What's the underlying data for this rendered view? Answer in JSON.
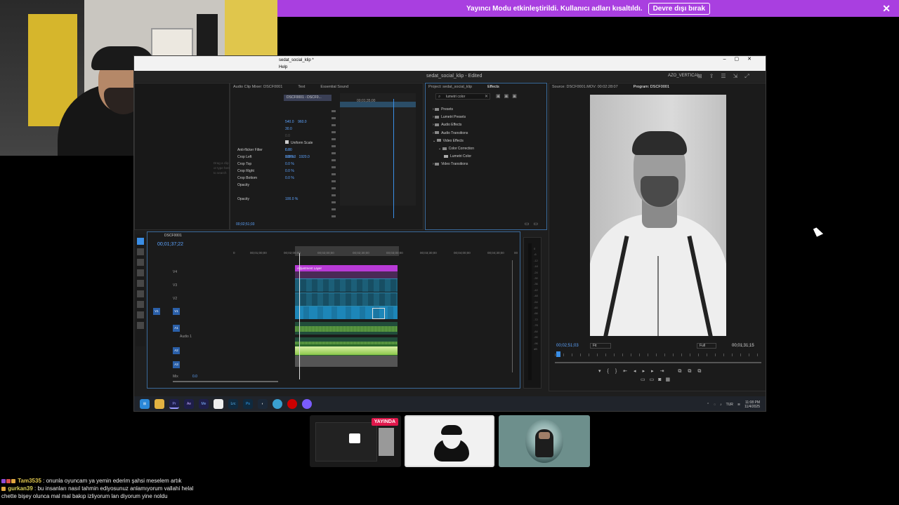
{
  "banner": {
    "text": "Yayıncı Modu etkinleştirildi. Kullanıcı adları kısaltıldı.",
    "button": "Devre dışı bırak"
  },
  "premiere": {
    "window_title": "sedat_social_klip *",
    "menu": "Help",
    "document_title": "sedat_social_klip - Edited",
    "workspace": "AZO_VERTICAL",
    "effect_controls": {
      "tabs": [
        "Audio Clip Mixer: DSCF0001",
        "Text",
        "Essential Sound"
      ],
      "clip_chip": "DSCF0001 - DSCF0...",
      "timeline_time": "00;01;35;00",
      "values_top": [
        "540.0",
        "960.0",
        "30.0"
      ],
      "uniform_scale": "Uniform Scale",
      "values_mid": [
        "0.0",
        "1080.0",
        "1920.0"
      ],
      "rows": [
        "Anti-flicker Filter",
        "Crop Left",
        "Crop Top",
        "Crop Right",
        "Crop Bottom",
        "Opacity",
        "",
        "Opacity"
      ],
      "row_values": [
        "0.00",
        "0.0 %",
        "0.0 %",
        "0.0 %",
        "0.0 %",
        "",
        "",
        "100.0 %"
      ],
      "time": "00;02;51;03",
      "left_hint": "Drag a clip or type here to search"
    },
    "project": {
      "tabs": [
        "Project: sedat_social_klip",
        "Effects"
      ],
      "search": "lumetri color",
      "tree": [
        {
          "label": "Presets",
          "indent": 0
        },
        {
          "label": "Lumetri Presets",
          "indent": 0
        },
        {
          "label": "Audio Effects",
          "indent": 0
        },
        {
          "label": "Audio Transitions",
          "indent": 0
        },
        {
          "label": "Video Effects",
          "indent": 0
        },
        {
          "label": "Color Correction",
          "indent": 1
        },
        {
          "label": "Lumetri Color",
          "indent": 2
        },
        {
          "label": "Video Transitions",
          "indent": 0
        }
      ]
    },
    "program": {
      "tabs": [
        "Source: DSCF0001.MOV: 00:02:28:07",
        "Program: DSCF0001"
      ],
      "current_time": "00;02;51;03",
      "fit": "Fit",
      "resolution": "Full",
      "duration": "00;01;31;15"
    },
    "timeline": {
      "sequence": "DSCF0001",
      "time": "00;01;37;22",
      "ruler": [
        "0",
        "00;01;00;00",
        "00;02;00;00",
        "00;02;00;00",
        "00;02;30;00",
        "00;03;00;00",
        "00;03;30;00",
        "00;04;00;00",
        "00;04;30;00",
        "00"
      ],
      "tracks": [
        "V4",
        "V3",
        "V2",
        "V1",
        "A1",
        "A2",
        "A3",
        "Mix"
      ],
      "audio_label": "Audio 1",
      "mix_value": "0.0",
      "adjustment_label": "Adjustment Layer",
      "meter_scale": [
        "0",
        "-6",
        "-12",
        "-18",
        "-24",
        "-30",
        "-36",
        "-42",
        "-48",
        "-54",
        "-60",
        "-66",
        "-72",
        "-78",
        "-84",
        "-90",
        "-96",
        "dB"
      ]
    },
    "taskbar": {
      "apps": [
        "Pr",
        "Ae",
        "Me",
        "Lrc",
        "Ps"
      ],
      "lang": "TUR",
      "clock_time": "11:08 PM",
      "clock_date": "11/4/2025"
    }
  },
  "participants": {
    "live_badge": "YAYINDA"
  },
  "chat": [
    {
      "user": "Tam3535",
      "message": "onunla oyuncam ya yemin ederim şahsi meselem artık"
    },
    {
      "user": "gurkan39",
      "message": "bu insanları nasıl tahmin ediyosunuz anlamıyorum vallahi helal"
    },
    {
      "user": "",
      "message": "chette bişey olunca mal mal bakıp izliyorum lan diyorum yine noldu"
    }
  ],
  "colors": {
    "banner": "#a93fe0",
    "premiere_accent": "#3a8ee6",
    "adjustment_clip": "#b83ad6",
    "live_badge": "#e0174b"
  }
}
